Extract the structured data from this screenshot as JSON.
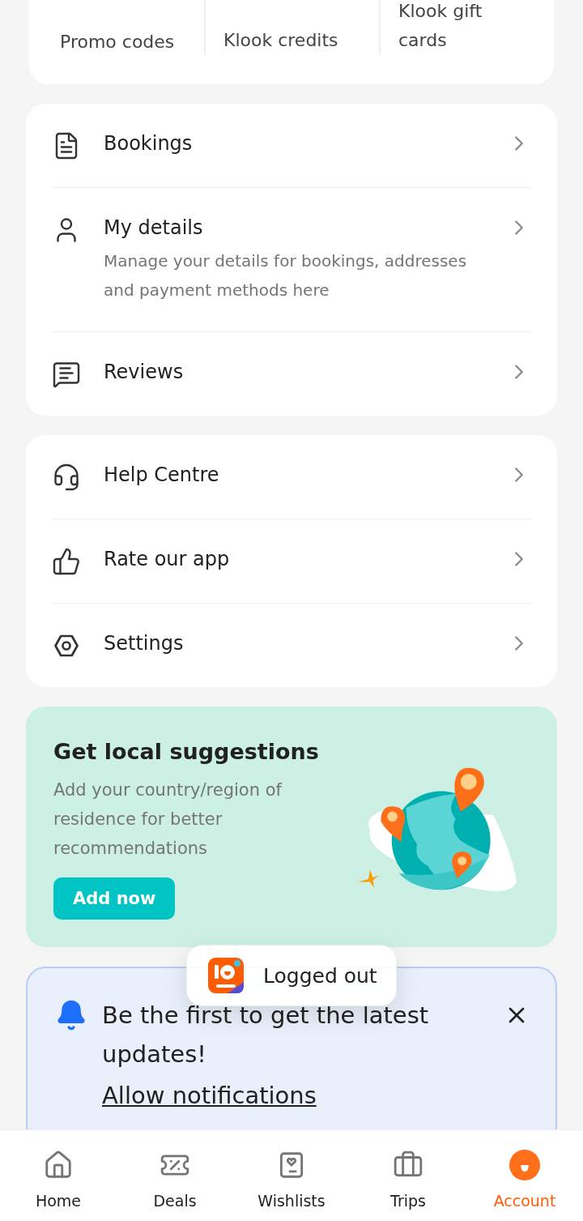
{
  "wallet_card": {
    "items": [
      {
        "label": "Promo codes"
      },
      {
        "label": "Klook credits"
      },
      {
        "label": "Klook gift cards"
      }
    ]
  },
  "menu_sections": [
    {
      "items": [
        {
          "title": "Bookings"
        },
        {
          "title": "My details",
          "description": "Manage your details for bookings, addresses and payment methods here"
        },
        {
          "title": "Reviews"
        }
      ]
    },
    {
      "items": [
        {
          "title": "Help Centre"
        },
        {
          "title": "Rate our app"
        },
        {
          "title": "Settings"
        }
      ]
    }
  ],
  "promo_card": {
    "title": "Get local suggestions",
    "text": "Add your country/region of residence for better recommendations",
    "button": "Add now"
  },
  "notification_card": {
    "text": "Be the first to get the latest updates!",
    "link": "Allow notifications"
  },
  "toast": {
    "text": "Logged out"
  },
  "bottom_nav": [
    {
      "label": "Home",
      "selected": false
    },
    {
      "label": "Deals",
      "selected": false
    },
    {
      "label": "Wishlists",
      "selected": false
    },
    {
      "label": "Trips",
      "selected": false
    },
    {
      "label": "Account",
      "selected": true
    }
  ]
}
